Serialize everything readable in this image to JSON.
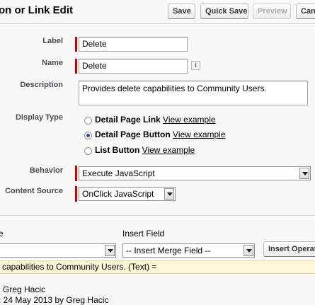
{
  "header": {
    "title": "on or Link Edit",
    "buttons": {
      "save": "Save",
      "quick_save": "Quick Save",
      "preview": "Preview",
      "cancel": "Cancel"
    }
  },
  "form": {
    "label": {
      "label": "Label",
      "value": "Delete"
    },
    "name": {
      "label": "Name",
      "value": "Delete",
      "info_icon": "i"
    },
    "description": {
      "label": "Description",
      "value": "Provides delete capabilities to Community Users."
    },
    "display_type": {
      "label": "Display Type",
      "options": [
        {
          "label": "Detail Page Link",
          "link": "View example",
          "checked": false
        },
        {
          "label": "Detail Page Button",
          "link": "View example",
          "checked": true
        },
        {
          "label": "List Button",
          "link": "View example",
          "checked": false
        }
      ]
    },
    "behavior": {
      "label": "Behavior",
      "value": "Execute JavaScript"
    },
    "content_source": {
      "label": "Content Source",
      "value": "OnClick JavaScript"
    }
  },
  "formula_tools": {
    "left_label": "e",
    "insert_field_label": "Insert Field",
    "insert_field_value": "-- Insert Merge Field --",
    "insert_operator_button": "Insert Operator"
  },
  "formula_bar": {
    "text": "capabilities to Community Users. (Text) ="
  },
  "footer": {
    "created_by": "Greg Hacic",
    "modified": ": 24 May 2013 by Greg Hacic"
  }
}
